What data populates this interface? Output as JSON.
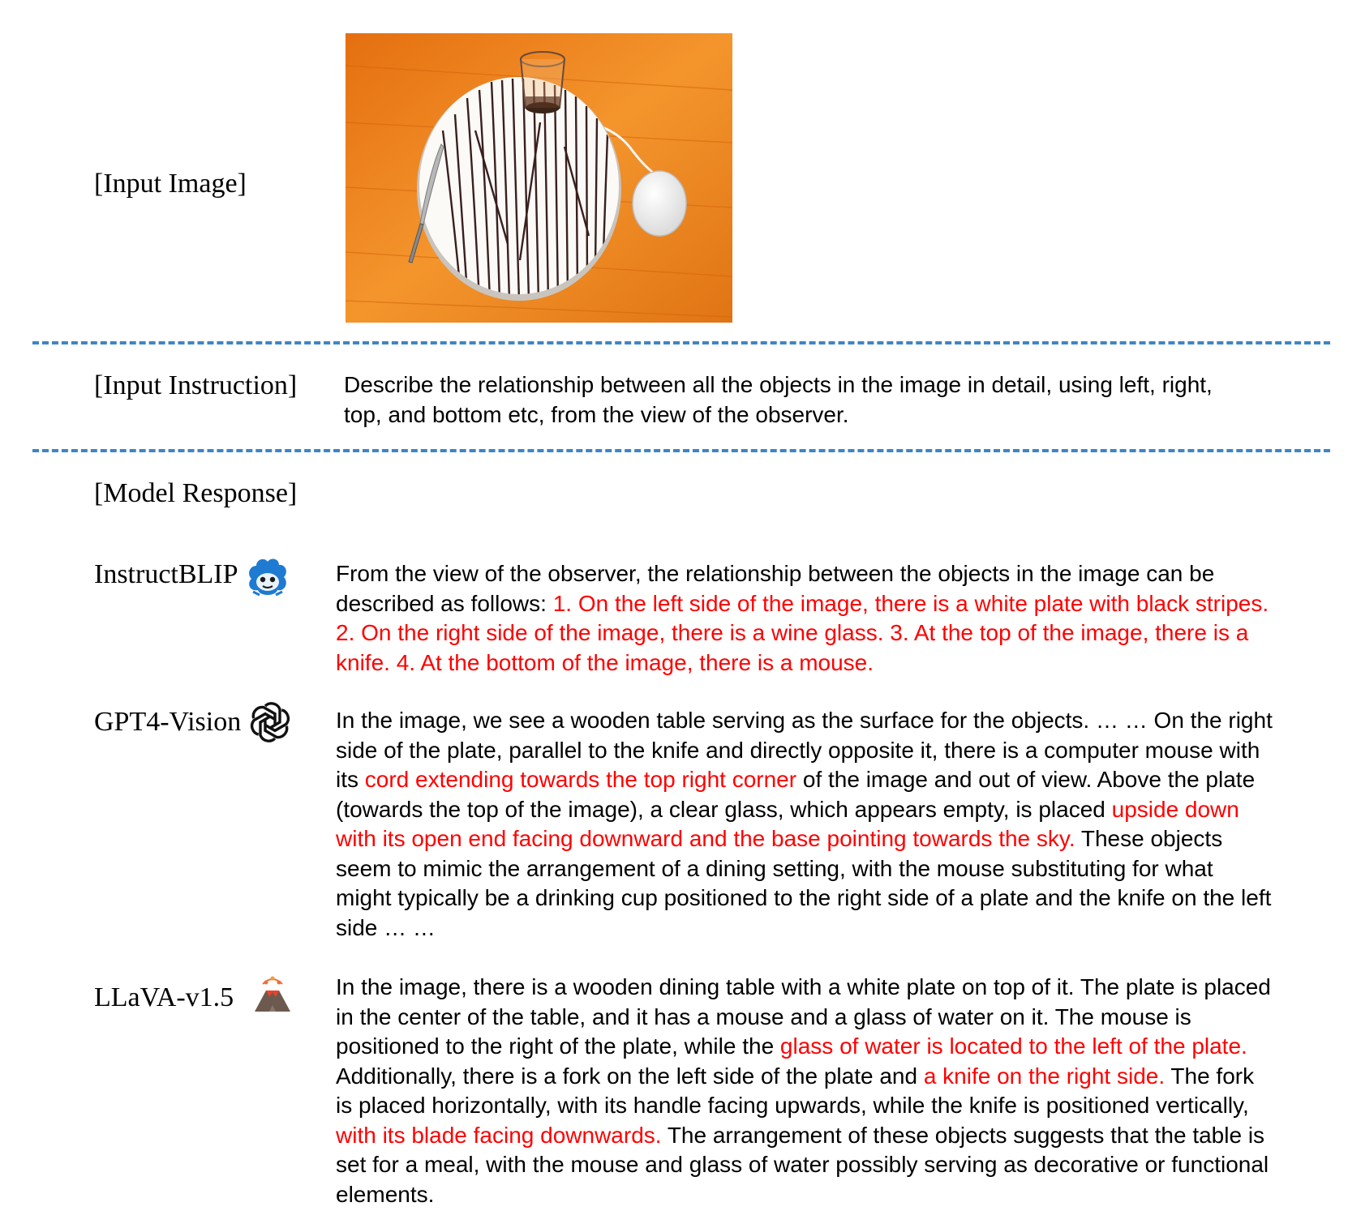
{
  "input_image": {
    "label": "[Input Image]"
  },
  "input_instruction": {
    "label": "[Input Instruction]",
    "text": "Describe the relationship between all the objects in the image in detail, using left, right, top, and bottom etc, from the view of the observer."
  },
  "model_response": {
    "label": "[Model Response]"
  },
  "responses": [
    {
      "model": "InstructBLIP",
      "icon": "instructblip-mascot-icon",
      "segments": [
        {
          "text": "From the view of the observer, the relationship between the objects in the image can be described as follows: ",
          "highlight": false
        },
        {
          "text": "1. On the left side of the image, there is a white plate with black stripes. 2. On the right side of the image, there is a wine glass. 3. At the top of the image, there is a knife. 4. At the bottom of the image, there is a mouse.",
          "highlight": true
        }
      ]
    },
    {
      "model": "GPT4-Vision",
      "icon": "openai-logo-icon",
      "segments": [
        {
          "text": "In the image, we see a wooden table serving as the surface for the objects. … … On the right side of the plate, parallel to the knife and directly opposite it, there is a computer mouse with its ",
          "highlight": false
        },
        {
          "text": "cord extending towards the top right corner",
          "highlight": true
        },
        {
          "text": " of the image and out of view. Above the plate (towards the top of the image), a clear glass, which appears empty, is placed ",
          "highlight": false
        },
        {
          "text": "upside down with its open end facing downward and the base pointing towards the sky.",
          "highlight": true
        },
        {
          "text": " These objects seem to mimic the arrangement of a dining setting, with the mouse substituting for what might typically be a drinking cup positioned to the right side of a plate and the knife on the left side … …",
          "highlight": false
        }
      ]
    },
    {
      "model": "LLaVA-v1.5",
      "icon": "volcano-icon",
      "segments": [
        {
          "text": "In the image, there is a wooden dining table with a white plate on top of it. The plate is placed in the center of the table, and it has a mouse and a glass of water on it. The mouse is positioned to the right of the plate, while the ",
          "highlight": false
        },
        {
          "text": "glass of water is located to the left of the plate.",
          "highlight": true
        },
        {
          "text": " Additionally, there is a fork on the left side of the plate and ",
          "highlight": false
        },
        {
          "text": "a knife on the right side.",
          "highlight": true
        },
        {
          "text": " The fork is placed horizontally, with its handle facing upwards, while the knife is positioned vertically, ",
          "highlight": false
        },
        {
          "text": "with its blade facing downwards.",
          "highlight": true
        },
        {
          "text": " The arrangement of these objects suggests that the table is set for a meal, with the mouse and glass of water possibly serving as decorative or functional elements.",
          "highlight": false
        }
      ]
    }
  ],
  "colors": {
    "highlight": "#ff0000",
    "divider": "#3d85c6",
    "table": "#f08a24"
  }
}
